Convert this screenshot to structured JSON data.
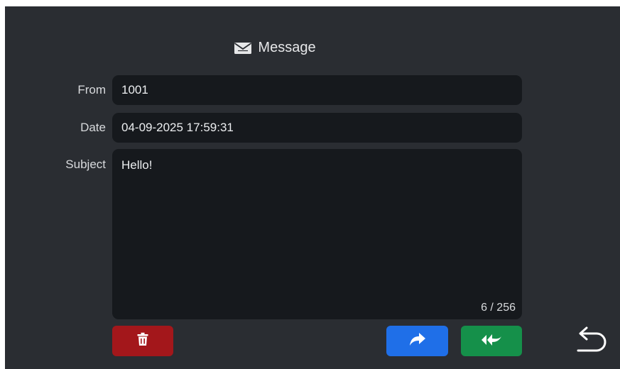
{
  "header": {
    "title": "Message",
    "icon": "envelope-icon"
  },
  "fields": {
    "from_label": "From",
    "from_value": "1001",
    "date_label": "Date",
    "date_value": "04-09-2025 17:59:31",
    "subject_label": "Subject",
    "subject_value": "Hello!",
    "char_counter": "6 / 256"
  },
  "actions": {
    "delete_icon": "trash-icon",
    "forward_icon": "forward-arrow-icon",
    "reply_icon": "reply-all-icon",
    "back_icon": "back-arrow-icon"
  },
  "colors": {
    "background": "#2a2d32",
    "field_bg": "#16191d",
    "delete": "#a3171b",
    "forward": "#1f6fe8",
    "reply": "#15904a"
  }
}
